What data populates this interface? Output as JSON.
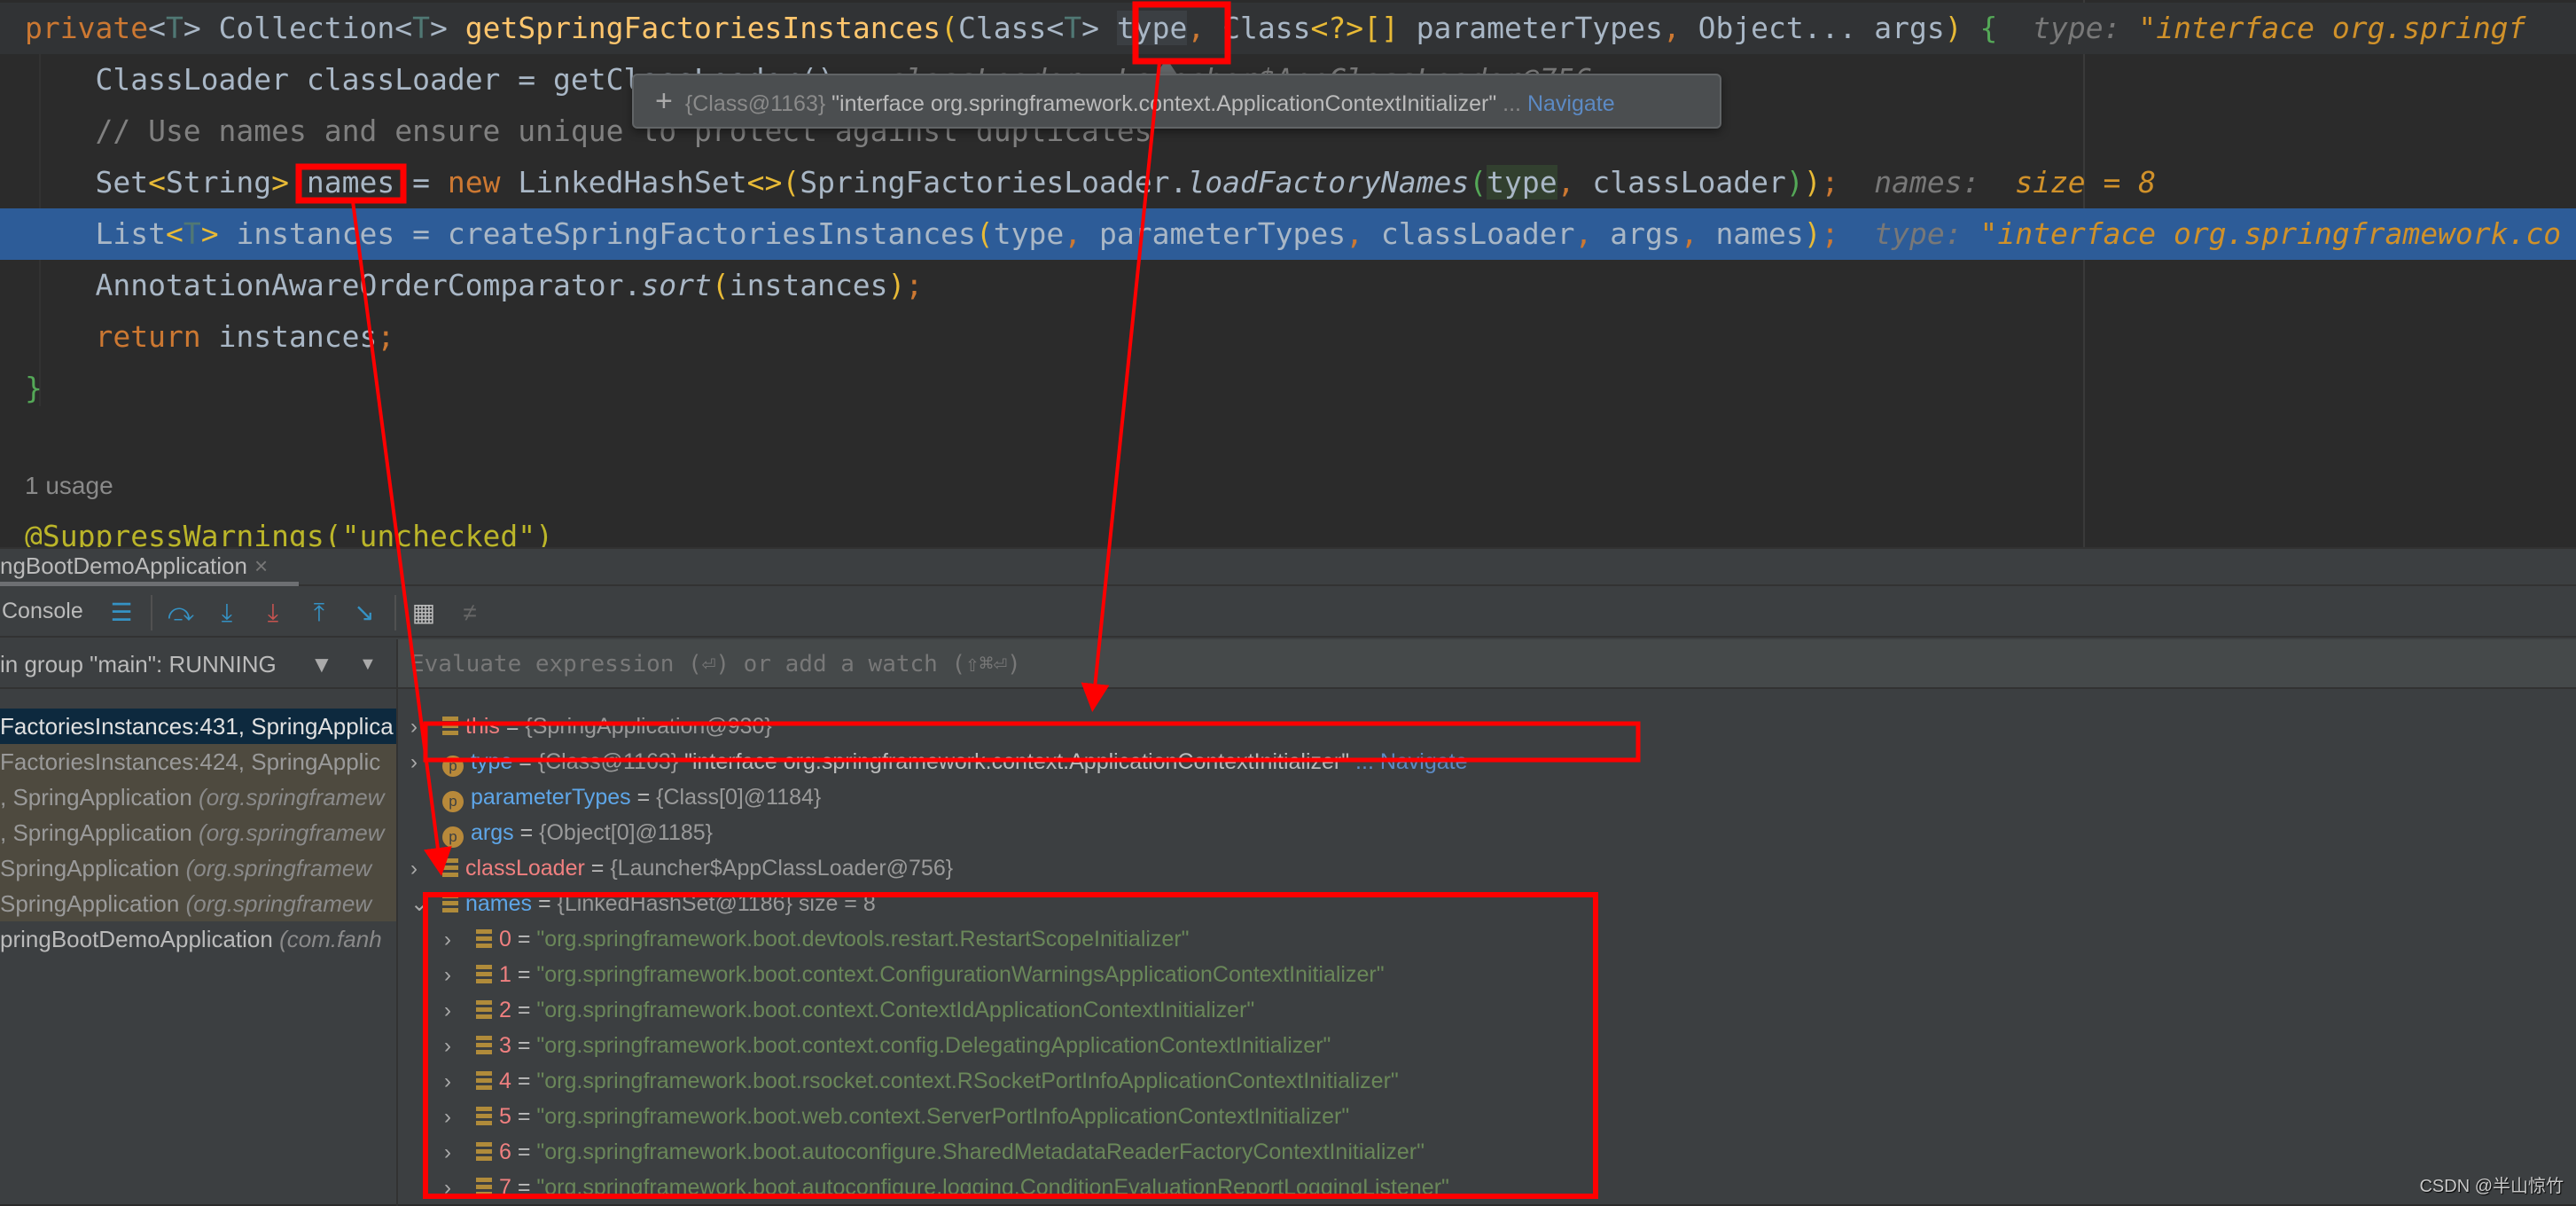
{
  "editor": {
    "lines": [
      [
        [
          "kw",
          "private"
        ],
        [
          "",
          "<"
        ],
        [
          "tp",
          "T"
        ],
        [
          "",
          "> Collection<"
        ],
        [
          "tp",
          "T"
        ],
        [
          "",
          "> "
        ],
        [
          "fn",
          "getSpringFactoriesInstances"
        ],
        [
          "pa",
          "("
        ],
        [
          "",
          "Class<"
        ],
        [
          "tp",
          "T"
        ],
        [
          "",
          "> "
        ],
        [
          "selword",
          "type"
        ],
        [
          "co",
          ", "
        ],
        [
          "",
          "Class"
        ],
        [
          "pa",
          "<?>[]"
        ],
        [
          "",
          " parameterTypes"
        ],
        [
          "co",
          ", "
        ],
        [
          "",
          "Object... args"
        ],
        [
          "pa",
          ")"
        ],
        [
          "",
          " "
        ],
        [
          "gr",
          "{"
        ],
        [
          "",
          "  "
        ],
        [
          "hint",
          "type: "
        ],
        [
          "hs",
          "\"interface org.springf"
        ]
      ],
      [
        [
          "",
          "    ClassLoader classLoader = getClassLoader();  "
        ],
        [
          "hint",
          "classLoader: Launcher$AppClassLoader@756"
        ]
      ],
      [
        [
          "cm",
          "    // Use names and ensure unique to protect against duplicates"
        ]
      ],
      [
        [
          "",
          "    Set"
        ],
        [
          "pa",
          "<"
        ],
        [
          "",
          "String"
        ],
        [
          "pa",
          ">"
        ],
        [
          "",
          " names = "
        ],
        [
          "kw",
          "new"
        ],
        [
          "",
          " LinkedHashSet"
        ],
        [
          "pa",
          "<>("
        ],
        [
          "",
          "SpringFactoriesLoader."
        ],
        [
          "it",
          "loadFactoryNames"
        ],
        [
          "gr",
          "("
        ],
        [
          "usage",
          "type"
        ],
        [
          "co",
          ", "
        ],
        [
          "",
          "classLoader"
        ],
        [
          "gr",
          ")"
        ],
        [
          "pa",
          ")"
        ],
        [
          "co",
          ";"
        ],
        [
          "",
          "  "
        ],
        [
          "hint",
          "names:  "
        ],
        [
          "hs",
          "size = 8"
        ]
      ],
      [
        [
          "",
          "    List"
        ],
        [
          "pa",
          "<"
        ],
        [
          "tp",
          "T"
        ],
        [
          "pa",
          ">"
        ],
        [
          "",
          " instances = createSpringFactoriesInstances"
        ],
        [
          "pa",
          "("
        ],
        [
          "",
          "type"
        ],
        [
          "co",
          ", "
        ],
        [
          "",
          "parameterTypes"
        ],
        [
          "co",
          ", "
        ],
        [
          "",
          "classLoader"
        ],
        [
          "co",
          ", "
        ],
        [
          "",
          "args"
        ],
        [
          "co",
          ", "
        ],
        [
          "",
          "names"
        ],
        [
          "pa",
          ")"
        ],
        [
          "co",
          ";"
        ],
        [
          "",
          "  "
        ],
        [
          "hint",
          "type: "
        ],
        [
          "hs",
          "\"interface org.springframework.co"
        ]
      ],
      [
        [
          "",
          "    AnnotationAwareOrderComparator."
        ],
        [
          "it",
          "sort"
        ],
        [
          "pa",
          "("
        ],
        [
          "",
          "instances"
        ],
        [
          "pa",
          ")"
        ],
        [
          "co",
          ";"
        ]
      ],
      [
        [
          "kw",
          "    return"
        ],
        [
          "",
          " instances"
        ],
        [
          "co",
          ";"
        ]
      ],
      [
        [
          "gr",
          "}"
        ]
      ]
    ],
    "usage": "1 usage",
    "annotation": "@SuppressWarnings(\"unchecked\")"
  },
  "tooltip": {
    "ref": "{Class@1163}",
    "value": "\"interface org.springframework.context.ApplicationContextInitializer\"",
    "ellipsis": " ...",
    "navigate": "Navigate"
  },
  "debug": {
    "tab": "ngBootDemoApplication",
    "tab_close": "×",
    "console_label": "Console",
    "thread": "in group \"main\": RUNNING",
    "eval_placeholder": "Evaluate expression (⏎) or add a watch (⇧⌘⏎)",
    "frames": [
      {
        "m": "FactoriesInstances:431, SpringApplica",
        "p": "",
        "kind": "sel"
      },
      {
        "m": "FactoriesInstances:424, SpringApplic",
        "p": "",
        "kind": "lib"
      },
      {
        "m": ", SpringApplication ",
        "p": "(org.springframew",
        "kind": "lib"
      },
      {
        "m": ", SpringApplication ",
        "p": "(org.springframew",
        "kind": "lib"
      },
      {
        "m": "SpringApplication ",
        "p": "(org.springframew",
        "kind": "lib"
      },
      {
        "m": "SpringApplication ",
        "p": "(org.springframew",
        "kind": "lib"
      },
      {
        "m": "pringBootDemoApplication ",
        "p": "(com.fanh",
        "kind": ""
      }
    ],
    "variables": [
      {
        "icon": "field",
        "cls": "vn-this",
        "name": "this",
        "ref": "{SpringApplication@930}",
        "expand": "›"
      },
      {
        "icon": "param",
        "cls": "vn-p",
        "name": "type",
        "ref": "{Class@1163}",
        "str": " \"interface org.springframework.context.ApplicationContextInitializer\"",
        "nav": " ... Navigate",
        "expand": "›"
      },
      {
        "icon": "param",
        "cls": "vn-p",
        "name": "parameterTypes",
        "ref": "{Class[0]@1184}",
        "expand": ""
      },
      {
        "icon": "param",
        "cls": "vn-p",
        "name": "args",
        "ref": "{Object[0]@1185}",
        "expand": ""
      },
      {
        "icon": "field",
        "cls": "vn-cl",
        "name": "classLoader",
        "ref": "{Launcher$AppClassLoader@756}",
        "expand": "›"
      },
      {
        "icon": "field",
        "cls": "vn-p",
        "name": "names",
        "ref": "{LinkedHashSet@1186}  size = 8",
        "expand": "⌄"
      }
    ],
    "names_items": [
      "\"org.springframework.boot.devtools.restart.RestartScopeInitializer\"",
      "\"org.springframework.boot.context.ConfigurationWarningsApplicationContextInitializer\"",
      "\"org.springframework.boot.context.ContextIdApplicationContextInitializer\"",
      "\"org.springframework.boot.context.config.DelegatingApplicationContextInitializer\"",
      "\"org.springframework.boot.rsocket.context.RSocketPortInfoApplicationContextInitializer\"",
      "\"org.springframework.boot.web.context.ServerPortInfoApplicationContextInitializer\"",
      "\"org.springframework.boot.autoconfigure.SharedMetadataReaderFactoryContextInitializer\"",
      "\"org.springframework.boot.autoconfigure.logging.ConditionEvaluationReportLoggingListener\""
    ]
  },
  "watermark": "CSDN @半山惊竹",
  "colors": {
    "annotation": "#ff0000",
    "highlight_line": "#2d5c98",
    "editor_bg": "#2b2b2b",
    "panel_bg": "#3c3f41"
  }
}
